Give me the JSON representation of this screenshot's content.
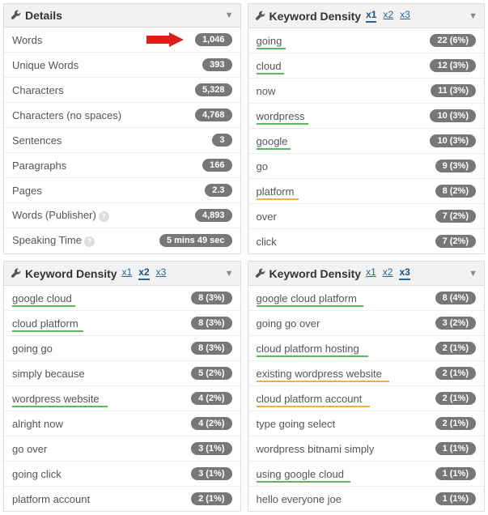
{
  "tabLabels": {
    "x1": "x1",
    "x2": "x2",
    "x3": "x3"
  },
  "details": {
    "title": "Details",
    "rows": [
      {
        "label": "Words",
        "value": "1,046",
        "arrow": true
      },
      {
        "label": "Unique Words",
        "value": "393"
      },
      {
        "label": "Characters",
        "value": "5,328"
      },
      {
        "label": "Characters (no spaces)",
        "value": "4,768"
      },
      {
        "label": "Sentences",
        "value": "3"
      },
      {
        "label": "Paragraphs",
        "value": "166"
      },
      {
        "label": "Pages",
        "value": "2.3"
      },
      {
        "label": "Words (Publisher)",
        "value": "4,893",
        "help": true
      },
      {
        "label": "Speaking Time",
        "value": "5 mins 49 sec",
        "help": true
      }
    ]
  },
  "kd1": {
    "title": "Keyword Density",
    "active": "x1",
    "rows": [
      {
        "label": "going",
        "value": "22 (6%)",
        "underline": "green",
        "uw": 36
      },
      {
        "label": "cloud",
        "value": "12 (3%)",
        "underline": "green",
        "uw": 34
      },
      {
        "label": "now",
        "value": "11 (3%)"
      },
      {
        "label": "wordpress",
        "value": "10 (3%)",
        "underline": "green",
        "uw": 64
      },
      {
        "label": "google",
        "value": "10 (3%)",
        "underline": "green",
        "uw": 42
      },
      {
        "label": "go",
        "value": "9 (3%)"
      },
      {
        "label": "platform",
        "value": "8 (2%)",
        "underline": "orange",
        "uw": 52
      },
      {
        "label": "over",
        "value": "7 (2%)"
      },
      {
        "label": "click",
        "value": "7 (2%)"
      }
    ]
  },
  "kd2": {
    "title": "Keyword Density",
    "active": "x2",
    "rows": [
      {
        "label": "google cloud",
        "value": "8 (3%)",
        "underline": "green",
        "uw": 78
      },
      {
        "label": "cloud platform",
        "value": "8 (3%)",
        "underline": "green",
        "uw": 88
      },
      {
        "label": "going go",
        "value": "8 (3%)"
      },
      {
        "label": "simply because",
        "value": "5 (2%)"
      },
      {
        "label": "wordpress website",
        "value": "4 (2%)",
        "underline": "green",
        "uw": 118
      },
      {
        "label": "alright now",
        "value": "4 (2%)"
      },
      {
        "label": "go over",
        "value": "3 (1%)"
      },
      {
        "label": "going click",
        "value": "3 (1%)"
      },
      {
        "label": "platform account",
        "value": "2 (1%)"
      }
    ]
  },
  "kd3": {
    "title": "Keyword Density",
    "active": "x3",
    "rows": [
      {
        "label": "google cloud platform",
        "value": "8 (4%)",
        "underline": "green",
        "uw": 132
      },
      {
        "label": "going go over",
        "value": "3 (2%)"
      },
      {
        "label": "cloud platform hosting",
        "value": "2 (1%)",
        "underline": "green",
        "uw": 138
      },
      {
        "label": "existing wordpress website",
        "value": "2 (1%)",
        "underline": "orange",
        "uw": 164
      },
      {
        "label": "cloud platform account",
        "value": "2 (1%)",
        "underline": "orange",
        "uw": 140
      },
      {
        "label": "type going select",
        "value": "2 (1%)"
      },
      {
        "label": "wordpress bitnami simply",
        "value": "1 (1%)"
      },
      {
        "label": "using google cloud",
        "value": "1 (1%)",
        "underline": "green",
        "uw": 116
      },
      {
        "label": "hello everyone joe",
        "value": "1 (1%)"
      }
    ]
  }
}
